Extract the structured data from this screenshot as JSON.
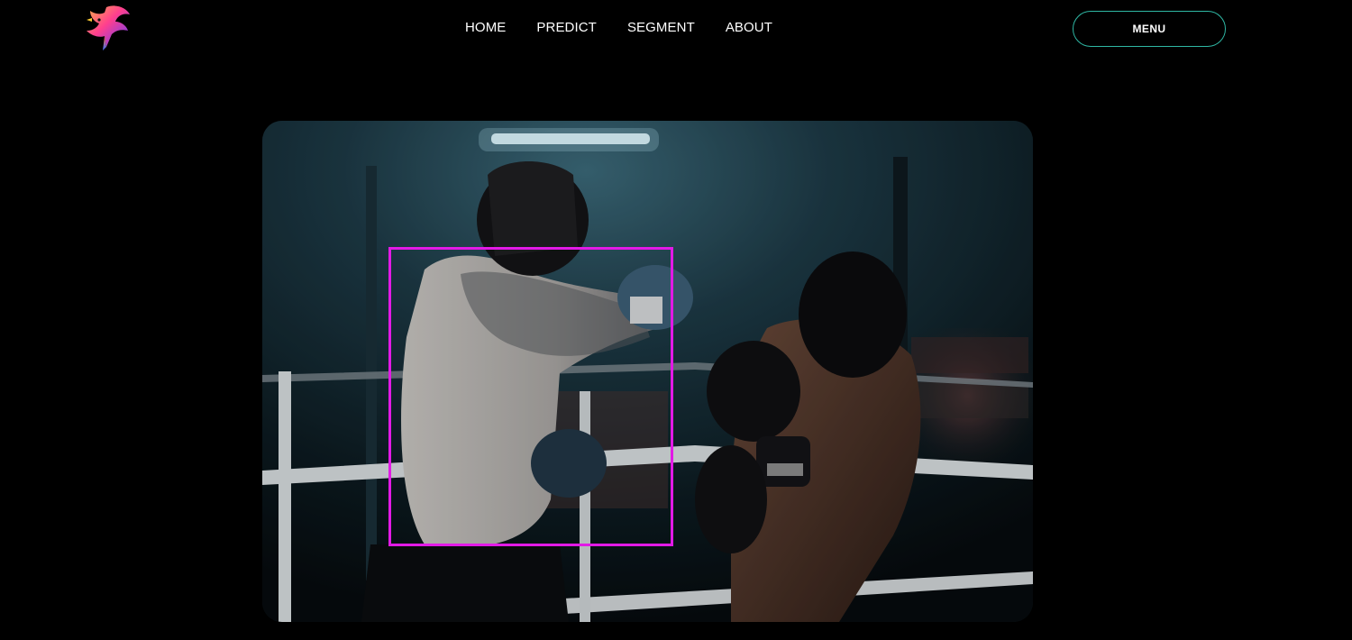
{
  "header": {
    "logo_icon": "phoenix-bird-logo",
    "nav": [
      {
        "label": "HOME"
      },
      {
        "label": "PREDICT"
      },
      {
        "label": "SEGMENT"
      },
      {
        "label": "ABOUT"
      }
    ],
    "menu_label": "MENU"
  },
  "main": {
    "image_subject": "boxing-sparring-photo",
    "detection": {
      "color": "#e21ae6",
      "object": "person-detection-box"
    }
  },
  "colors": {
    "background": "#000000",
    "menu_border": "#2fb7a4",
    "detection_box": "#e21ae6"
  }
}
